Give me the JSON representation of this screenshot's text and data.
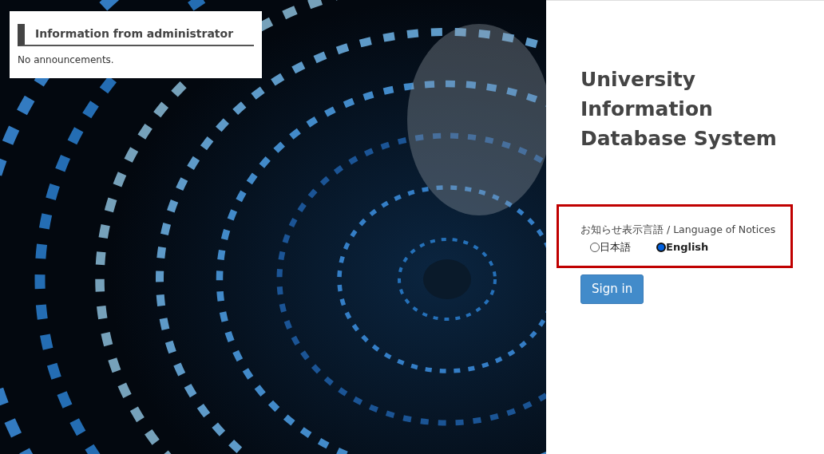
{
  "notice_panel": {
    "title": "Information from administrator",
    "message": "No announcements."
  },
  "app_title": [
    "University",
    "Information",
    "Database System"
  ],
  "notice_language": {
    "label": "お知らせ表示言語 / Language of Notices",
    "options": [
      {
        "label": "日本語",
        "selected": false
      },
      {
        "label": "English",
        "selected": true
      }
    ]
  },
  "sign_in_button": "Sign in"
}
